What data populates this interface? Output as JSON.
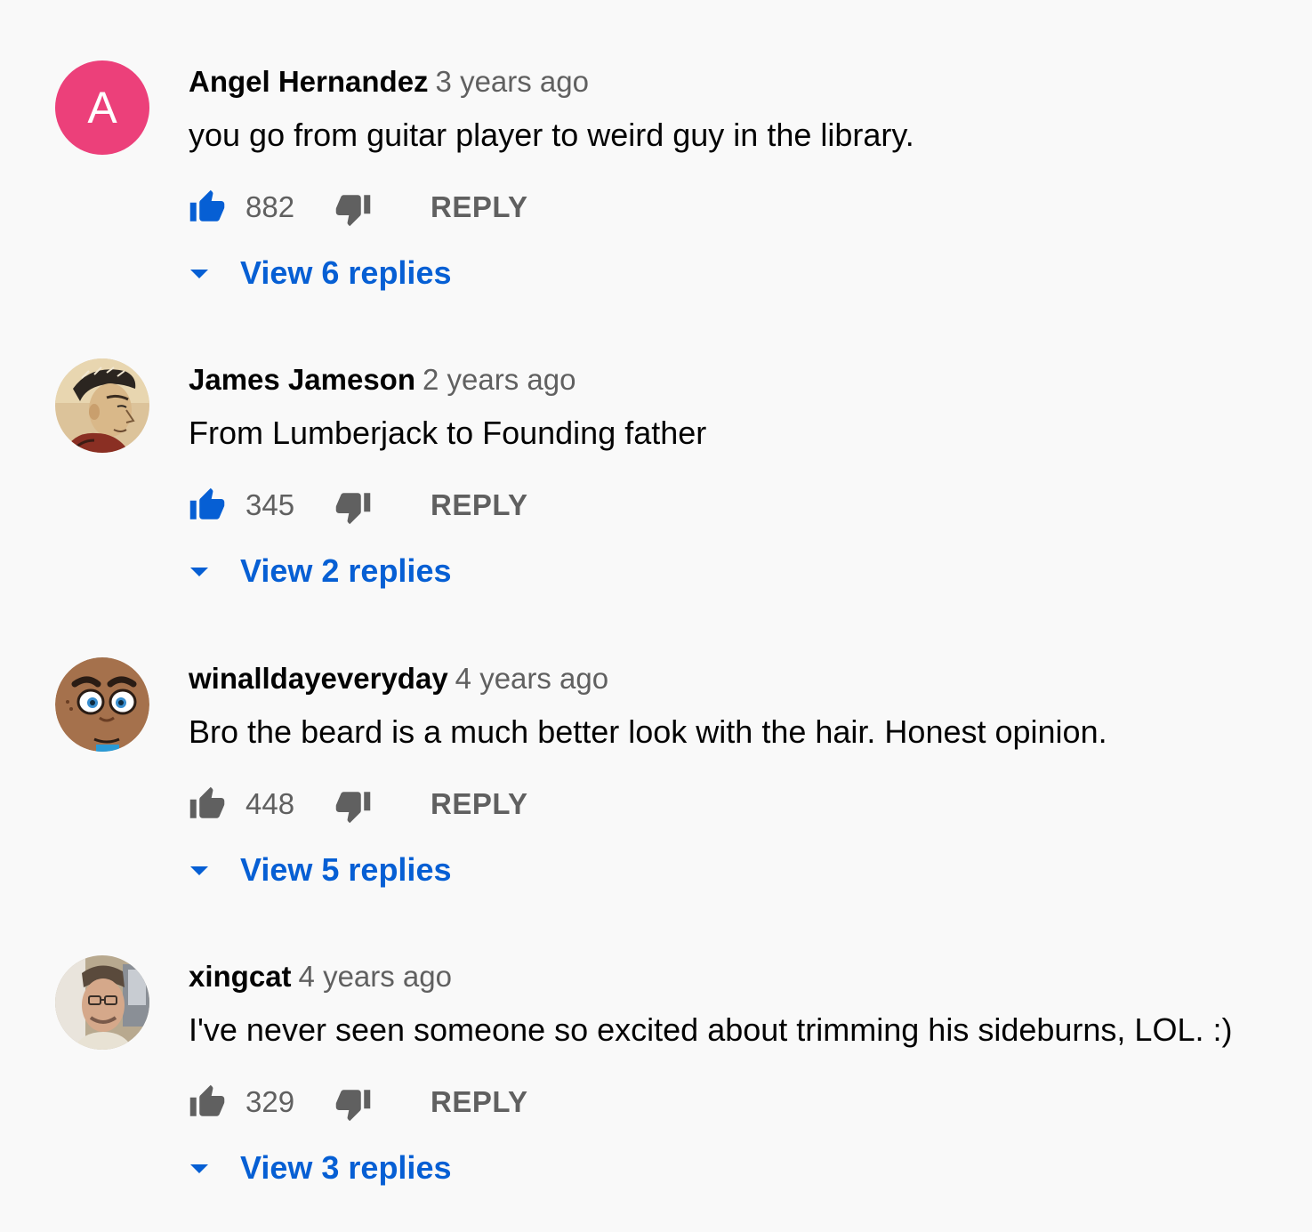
{
  "colors": {
    "like_active": "#065fd4",
    "like_inactive": "#606060",
    "link_blue": "#065fd4",
    "secondary_text": "#606060",
    "avatar_pink": "#ec407a"
  },
  "reply_label": "REPLY",
  "comments": [
    {
      "author": "Angel Hernandez",
      "time": "3 years ago",
      "text": "you go from guitar player to weird guy in the library.",
      "likes": "882",
      "liked": true,
      "view_replies": "View 6 replies",
      "avatar_letter": "A",
      "avatar_icon": "letter-avatar"
    },
    {
      "author": "James Jameson",
      "time": "2 years ago",
      "text": "From Lumberjack to Founding father",
      "likes": "345",
      "liked": true,
      "view_replies": "View 2 replies",
      "avatar_icon": "illustrated-profile-avatar"
    },
    {
      "author": "winalldayeveryday",
      "time": "4 years ago",
      "text": "Bro the beard is a much better look with the hair. Honest opinion.",
      "likes": "448",
      "liked": false,
      "view_replies": "View 5 replies",
      "avatar_icon": "cartoon-face-avatar"
    },
    {
      "author": "xingcat",
      "time": "4 years ago",
      "text": "I've never seen someone so excited about trimming his sideburns, LOL. :)",
      "likes": "329",
      "liked": false,
      "view_replies": "View 3 replies",
      "avatar_icon": "photo-avatar"
    }
  ]
}
